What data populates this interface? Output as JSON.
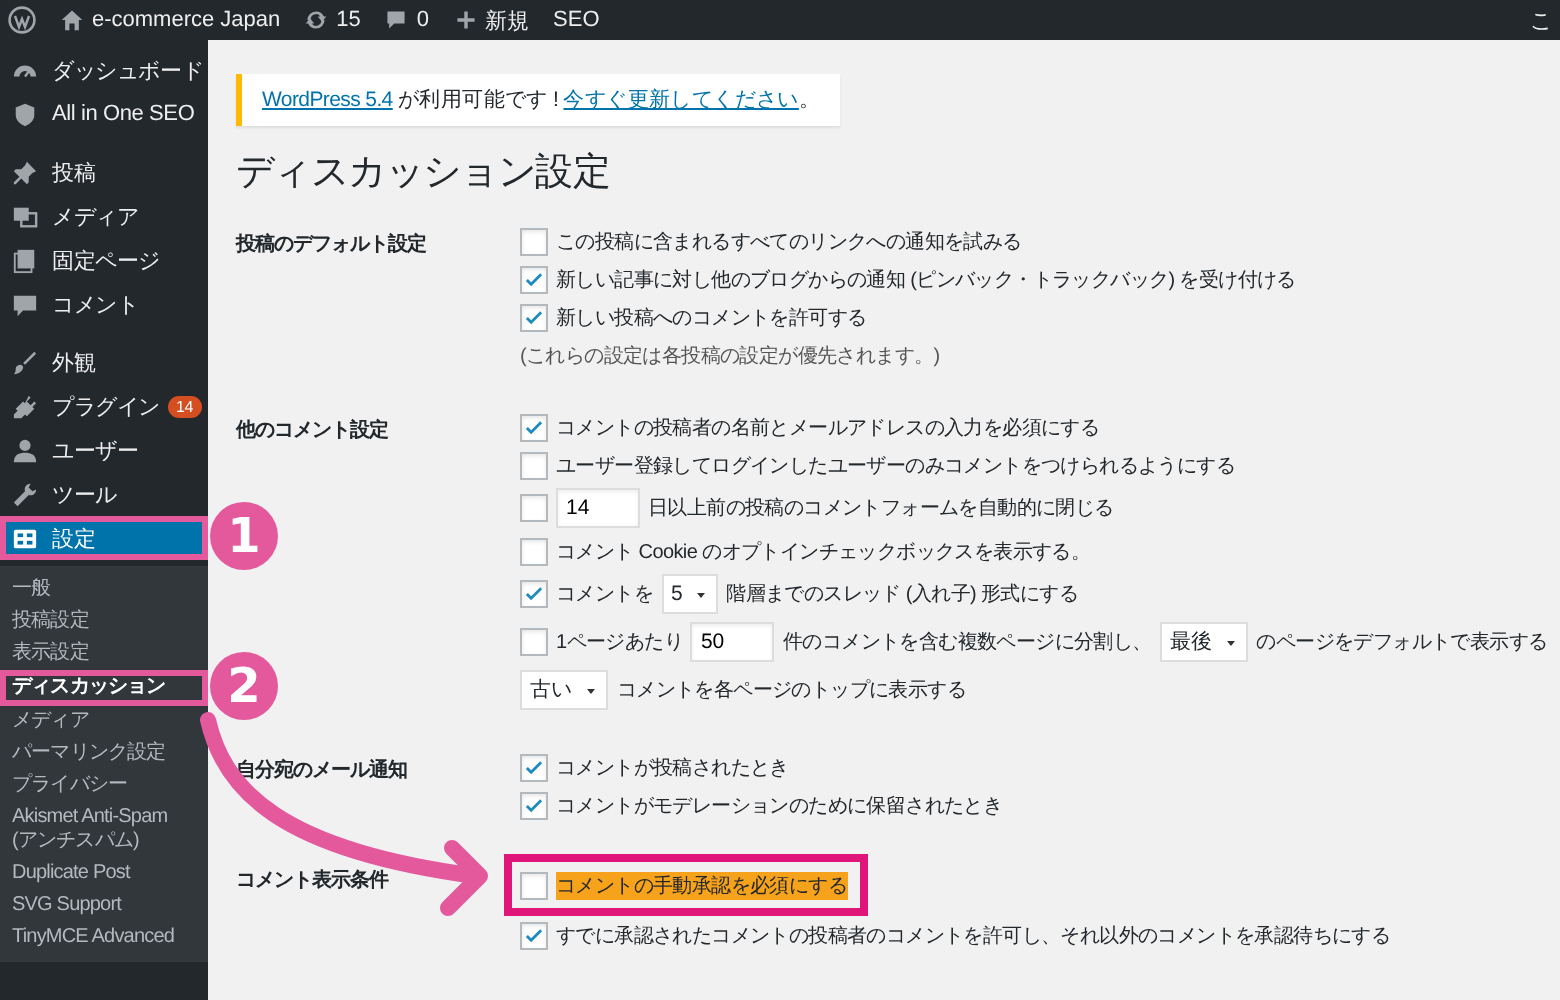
{
  "topbar": {
    "site": "e-commerce Japan",
    "updates": "15",
    "comments": "0",
    "new": "新規",
    "seo": "SEO",
    "greeting": "こ"
  },
  "sidebar": {
    "groups": [
      [
        {
          "label": "ダッシュボード",
          "selected": false
        },
        {
          "label": "All in One SEO",
          "selected": false
        }
      ],
      [
        {
          "label": "投稿",
          "selected": false
        },
        {
          "label": "メディア",
          "selected": false
        },
        {
          "label": "固定ページ",
          "selected": false
        },
        {
          "label": "コメント",
          "selected": false
        }
      ],
      [
        {
          "label": "外観",
          "selected": false
        },
        {
          "label": "プラグイン",
          "badge": "14",
          "selected": false
        },
        {
          "label": "ユーザー",
          "selected": false
        },
        {
          "label": "ツール",
          "selected": false
        },
        {
          "label": "設定",
          "selected": true
        }
      ]
    ],
    "submenu": [
      {
        "label": "一般",
        "selected": false
      },
      {
        "label": "投稿設定",
        "selected": false
      },
      {
        "label": "表示設定",
        "selected": false
      },
      {
        "label": "ディスカッション",
        "selected": true
      },
      {
        "label": "メディア",
        "selected": false
      },
      {
        "label": "パーマリンク設定",
        "selected": false
      },
      {
        "label": "プライバシー",
        "selected": false
      },
      {
        "label": "Akismet Anti-Spam (アンチスパム)",
        "selected": false
      },
      {
        "label": "Duplicate Post",
        "selected": false
      },
      {
        "label": "SVG Support",
        "selected": false
      },
      {
        "label": "TinyMCE Advanced",
        "selected": false
      }
    ]
  },
  "notice": {
    "link": "WordPress 5.4",
    "text": " が利用可能です ! ",
    "action": "今すぐ更新してください",
    "end": "。"
  },
  "title": "ディスカッション設定",
  "sections": [
    {
      "label": "投稿のデフォルト設定",
      "items": [
        {
          "kind": "checkbox",
          "checked": false,
          "highlighted": false,
          "parts": [
            {
              "kind": "text",
              "text": "この投稿に含まれるすべてのリンクへの通知を試みる"
            }
          ]
        },
        {
          "kind": "checkbox",
          "checked": true,
          "highlighted": false,
          "parts": [
            {
              "kind": "text",
              "text": "新しい記事に対し他のブログからの通知 (ピンバック・トラックバック) を受け付ける"
            }
          ]
        },
        {
          "kind": "checkbox",
          "checked": true,
          "highlighted": false,
          "parts": [
            {
              "kind": "text",
              "text": "新しい投稿へのコメントを許可する"
            }
          ]
        },
        {
          "kind": "note",
          "parts": [
            {
              "kind": "text",
              "text": "(これらの設定は各投稿の設定が優先されます。)"
            }
          ]
        }
      ]
    },
    {
      "label": "他のコメント設定",
      "items": [
        {
          "kind": "checkbox",
          "checked": true,
          "highlighted": false,
          "parts": [
            {
              "kind": "text",
              "text": "コメントの投稿者の名前とメールアドレスの入力を必須にする"
            }
          ]
        },
        {
          "kind": "checkbox",
          "checked": false,
          "highlighted": false,
          "parts": [
            {
              "kind": "text",
              "text": "ユーザー登録してログインしたユーザーのみコメントをつけられるようにする"
            }
          ]
        },
        {
          "kind": "checkbox",
          "checked": false,
          "highlighted": false,
          "parts": [
            {
              "kind": "input",
              "value": "14"
            },
            {
              "kind": "text",
              "text": "日以上前の投稿のコメントフォームを自動的に閉じる"
            }
          ]
        },
        {
          "kind": "checkbox",
          "checked": false,
          "highlighted": false,
          "parts": [
            {
              "kind": "text",
              "text": "コメント Cookie のオプトインチェックボックスを表示する。"
            }
          ]
        },
        {
          "kind": "checkbox",
          "checked": true,
          "highlighted": false,
          "parts": [
            {
              "kind": "text",
              "text": "コメントを"
            },
            {
              "kind": "select",
              "value": "5"
            },
            {
              "kind": "text",
              "text": "階層までのスレッド (入れ子) 形式にする"
            }
          ]
        },
        {
          "kind": "checkbox",
          "checked": false,
          "highlighted": false,
          "parts": [
            {
              "kind": "text",
              "text": "1ページあたり"
            },
            {
              "kind": "input",
              "value": "50"
            },
            {
              "kind": "text",
              "text": "件のコメントを含む複数ページに分割し、"
            },
            {
              "kind": "select",
              "value": "最後"
            },
            {
              "kind": "text",
              "text": "のページをデフォルトで表示する"
            }
          ]
        },
        {
          "kind": "plain",
          "parts": [
            {
              "kind": "select",
              "value": "古い"
            },
            {
              "kind": "text",
              "text": "コメントを各ページのトップに表示する"
            }
          ]
        }
      ]
    },
    {
      "label": "自分宛のメール通知",
      "items": [
        {
          "kind": "checkbox",
          "checked": true,
          "highlighted": false,
          "parts": [
            {
              "kind": "text",
              "text": "コメントが投稿されたとき"
            }
          ]
        },
        {
          "kind": "checkbox",
          "checked": true,
          "highlighted": false,
          "parts": [
            {
              "kind": "text",
              "text": "コメントがモデレーションのために保留されたとき"
            }
          ]
        }
      ]
    },
    {
      "label": "コメント表示条件",
      "items": [
        {
          "kind": "checkbox",
          "checked": false,
          "highlighted": true,
          "parts": [
            {
              "kind": "text",
              "text": "コメントの手動承認を必須にする"
            }
          ]
        },
        {
          "kind": "checkbox",
          "checked": true,
          "highlighted": false,
          "parts": [
            {
              "kind": "text",
              "text": "すでに承認されたコメントの投稿者のコメントを許可し、それ以外のコメントを承認待ちにする"
            }
          ]
        }
      ]
    }
  ],
  "annotations": [
    {
      "label": "1"
    },
    {
      "label": "2"
    }
  ]
}
